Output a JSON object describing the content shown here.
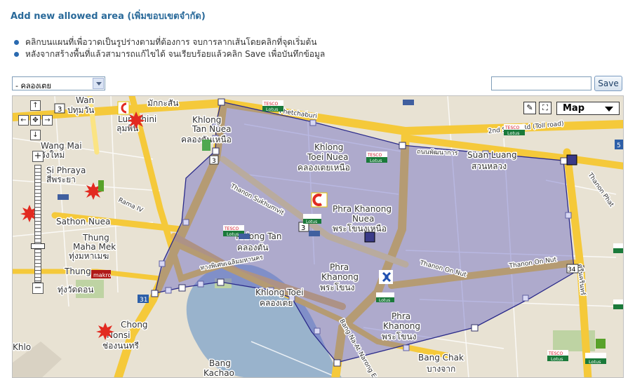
{
  "header": {
    "title": "Add new allowed area (เพิ่มขอบเขตจำกัด)"
  },
  "instructions": [
    "คลิกบนแผนที่เพื่อวาดเป็นรูปร่างตามที่ต้องการ จบการลากเส้นโดยคลิกที่จุดเริ่มต้น",
    "หลังจากสร้างพื้นที่แล้วสามารถแก้ไขได้ จนเรียบร้อยแล้วคลิก Save เพื่อบันทึกข้อมูล"
  ],
  "toolbar": {
    "area_select_value": "- คลองเตย",
    "name_input_value": "",
    "save_label": "Save"
  },
  "map": {
    "type_label": "Map",
    "zoom_in": "+",
    "zoom_out": "−",
    "labels": {
      "wang_mai": "Wang Mai",
      "wang_mai_th": "วังใหม่",
      "si_phraya": "Si Phraya",
      "si_phraya_th": "สี่พระยา",
      "rama4": "Rama IV",
      "sathon_nuea": "Sathon Nuea",
      "thung_maha_mek": "Thung\nMaha Mek",
      "thung_maha_mek_line1": "Thung",
      "thung_maha_mek_line2": "Maha Mek",
      "thung_maha_mek_th": "ทุ่งมหาเมฆ",
      "thung": "Thung",
      "thung_wat_don_th": "ทุ่งวัดดอน",
      "chong_nonsi_line1": "Chong",
      "chong_nonsi_line2": "Nonsi",
      "chong_nonsi_th": "ช่องนนทรี",
      "khlo": "Khlo",
      "pathum_wan_th": "ปทุมวัน",
      "wan": "Wan",
      "lumphini": "Lumphini",
      "lumphini_th": "ลุมพินี",
      "makkasan_th": "มักกะสัน",
      "khlong_tan_nuea": "Khlong\nTan Nuea",
      "khlong_tan_nuea_line1": "Khlong",
      "khlong_tan_nuea_line2": "Tan Nuea",
      "khlong_tan_nuea_th": "คลองตันเหนือ",
      "khlong_toei_nuea_line1": "Khlong",
      "khlong_toei_nuea_line2": "Toei Nuea",
      "khlong_toei_nuea_th": "คลองเตยเหนือ",
      "phra_khanong_nuea_line1": "Phra Khanong",
      "phra_khanong_nuea_line2": "Nuea",
      "phra_khanong_nuea_th": "พระโขนงเหนือ",
      "khlong_tan": "Khlong Tan",
      "khlong_tan_th": "คลองตัน",
      "phra_khanong_line1": "Phra",
      "phra_khanong_line2": "Khanong",
      "phra_khanong_th": "พระโขนง",
      "khlong_toei": "Khlong Toei",
      "khlong_toei_th": "คลองเตย",
      "phra_khanong2_line1": "Phra",
      "phra_khanong2_line2": "Khanong",
      "phra_khanong2_th": "พระโขนง",
      "bang_chak": "Bang Chak",
      "bang_chak_th": "บางจาก",
      "bang_kachao_line1": "Bang",
      "bang_kachao_line2": "Kachao",
      "suan_luang": "Suan Luang",
      "suan_luang_th": "สวนหลวง",
      "thanon_on_nut": "Thanon On Nut",
      "thanon_on_nut2": "Thanon On Nut",
      "thanon_sukhumvit": "Thanon Sukhumvit",
      "second_stage": "2nd Stage Rd (Toll road)",
      "phet_chaburi": "Phetchaburi",
      "bang_na_at_narong": "Bang Na-At Narong Expy",
      "thanon_phat": "Thanon Phat",
      "tesco_lotus": "Lotus",
      "tesco": "TESCO",
      "makro": "makro",
      "road_3": "3",
      "road_31": "31",
      "road_34": "34",
      "road_5": "5",
      "kanchanaphisek_th": "ถนนพัฒนาการ",
      "chalerm_th": "ทางพิเศษเฉลิมมหานคร",
      "srinakarin_th": "ศรีนครินทร์"
    }
  },
  "colors": {
    "title": "#2a6a9a",
    "bullet": "#2a6ab0",
    "polygon_fill": "#5c5cc4",
    "polygon_stroke": "#2a2a8a",
    "road_major": "#f5c93a",
    "road_minor": "#fbe483",
    "water": "#99b3cc",
    "land": "#e6e0d2",
    "park": "#bed3a3"
  }
}
